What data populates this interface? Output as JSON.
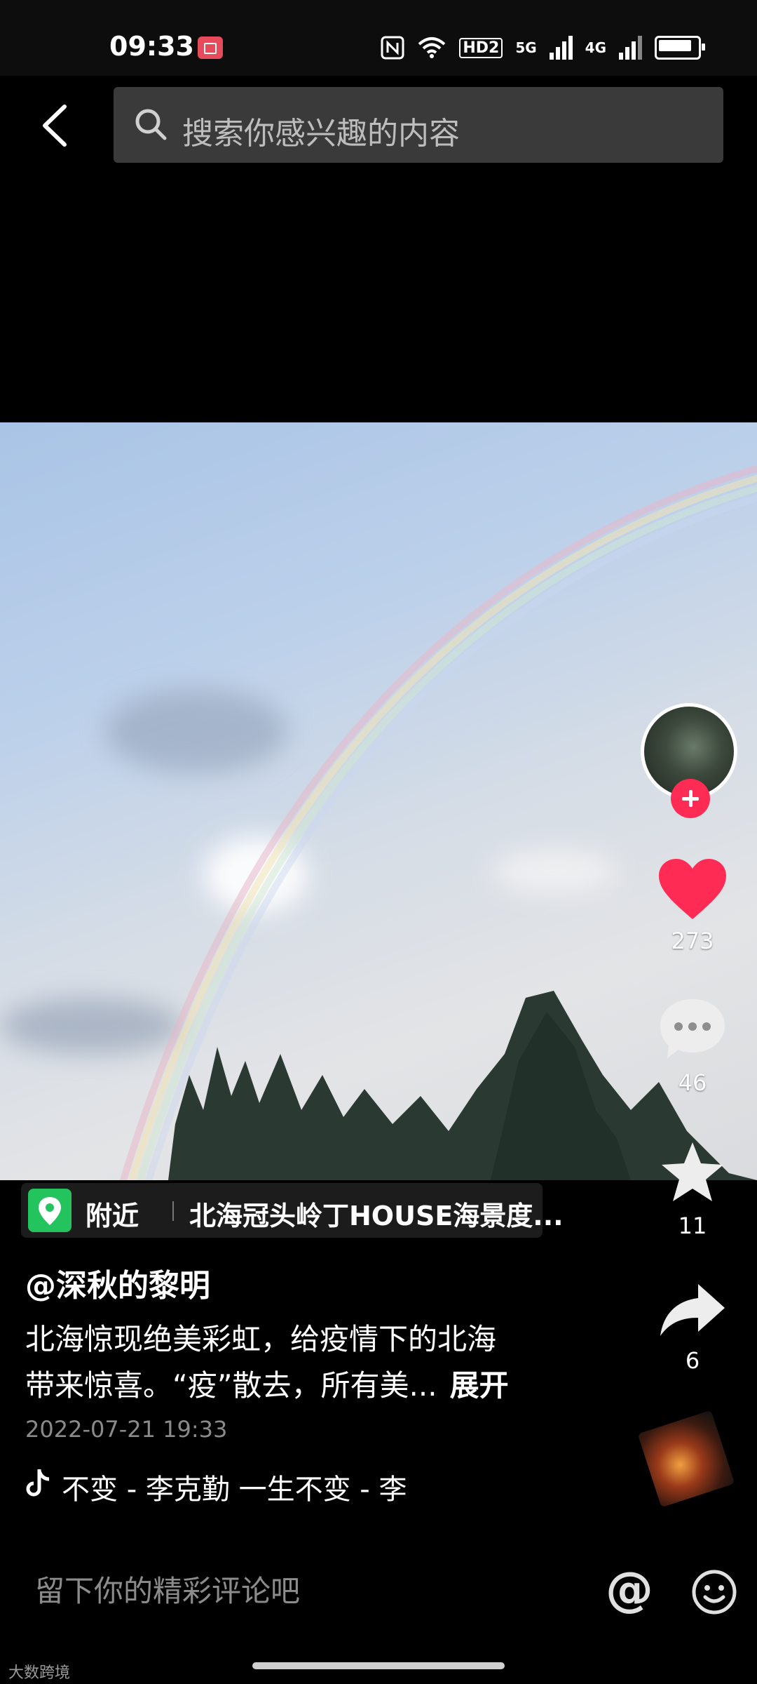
{
  "status_bar": {
    "time": "09:33",
    "network": "5G",
    "network2": "4G",
    "hd": "HD2"
  },
  "search": {
    "placeholder": "搜索你感兴趣的内容"
  },
  "actions": {
    "likes": "273",
    "comments": "46",
    "favorites": "11",
    "shares": "6"
  },
  "location": {
    "label": "附近",
    "place": "北海冠头岭丁HOUSE海景度..."
  },
  "post": {
    "author": "@深秋的黎明",
    "desc_line1": "北海惊现绝美彩虹，给疫情下的北海",
    "desc_line2": "带来惊喜。“疫”散去，所有美...",
    "expand": "展开",
    "date": "2022-07-21 19:33",
    "music": "不变 - 李克勤    一生不变 - 李"
  },
  "comment": {
    "placeholder": "留下你的精彩评论吧",
    "at": "@"
  },
  "watermark": "大数跨境",
  "colors": {
    "like": "#fe2c55",
    "location": "#23c45e",
    "record": "#e54b5b"
  }
}
